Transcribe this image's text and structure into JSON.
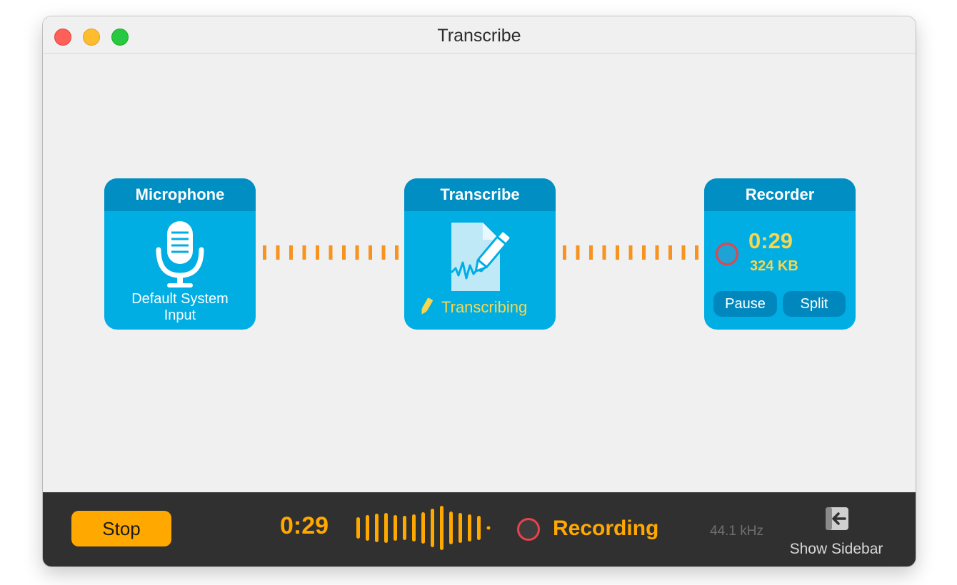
{
  "window": {
    "title": "Transcribe"
  },
  "nodes": {
    "microphone": {
      "title": "Microphone",
      "label_line1": "Default System",
      "label_line2": "Input"
    },
    "transcribe": {
      "title": "Transcribe",
      "status": "Transcribing"
    },
    "recorder": {
      "title": "Recorder",
      "time": "0:29",
      "size": "324 KB",
      "pause_label": "Pause",
      "split_label": "Split"
    }
  },
  "bottom_bar": {
    "stop_label": "Stop",
    "time": "0:29",
    "recording_label": "Recording",
    "sample_rate": "44.1 kHz",
    "show_sidebar_label": "Show Sidebar"
  },
  "colors": {
    "node_body": "#00aee4",
    "node_header": "#008ec3",
    "connector": "#f7931e",
    "accent_orange": "#ffa800",
    "accent_yellow": "#f8d64e",
    "record_red": "#e8424b",
    "bottom_bar": "#303030"
  },
  "icons": {
    "microphone": "microphone-icon",
    "document": "document-pen-icon",
    "pencil": "pencil-icon",
    "record": "record-circle-icon",
    "waveform": "waveform-icon",
    "sidebar": "arrow-left-box-icon"
  }
}
